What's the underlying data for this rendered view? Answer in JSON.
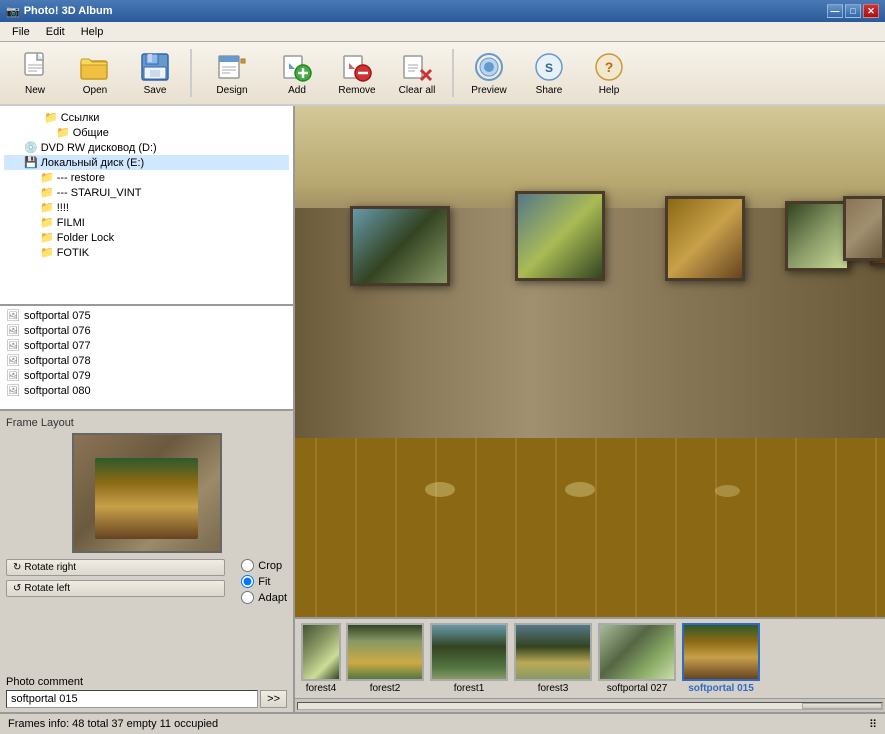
{
  "title_bar": {
    "icon": "📷",
    "title": "Photo! 3D Album",
    "min_btn": "—",
    "max_btn": "□",
    "close_btn": "✕"
  },
  "menu": {
    "items": [
      "File",
      "Edit",
      "Help"
    ]
  },
  "toolbar": {
    "buttons": [
      {
        "id": "new",
        "label": "New",
        "icon": "new"
      },
      {
        "id": "open",
        "label": "Open",
        "icon": "open"
      },
      {
        "id": "save",
        "label": "Save",
        "icon": "save"
      },
      {
        "id": "design",
        "label": "Design",
        "icon": "design"
      },
      {
        "id": "add",
        "label": "Add",
        "icon": "add"
      },
      {
        "id": "remove",
        "label": "Remove",
        "icon": "remove"
      },
      {
        "id": "clearall",
        "label": "Clear all",
        "icon": "clear"
      },
      {
        "id": "preview",
        "label": "Preview",
        "icon": "preview"
      },
      {
        "id": "share",
        "label": "Share",
        "icon": "share"
      },
      {
        "id": "help",
        "label": "Help",
        "icon": "help"
      }
    ]
  },
  "file_tree": {
    "items": [
      {
        "label": "Ссылки",
        "indent": 40,
        "icon": "📁"
      },
      {
        "label": "Общие",
        "indent": 52,
        "icon": "📁"
      },
      {
        "label": "DVD RW дисковод (D:)",
        "indent": 20,
        "icon": "💿"
      },
      {
        "label": "Локальный диск (E:)",
        "indent": 20,
        "icon": "💾"
      },
      {
        "label": "--- restore",
        "indent": 36,
        "icon": "📁"
      },
      {
        "label": "--- STARUI_VINT",
        "indent": 36,
        "icon": "📁"
      },
      {
        "label": "!!!!",
        "indent": 36,
        "icon": "📁"
      },
      {
        "label": "FILMI",
        "indent": 36,
        "icon": "📁"
      },
      {
        "label": "Folder Lock",
        "indent": 36,
        "icon": "📁"
      },
      {
        "label": "FOTIK",
        "indent": 36,
        "icon": "📁"
      }
    ]
  },
  "file_list": {
    "items": [
      {
        "label": "softportal 075",
        "icon": "🖼"
      },
      {
        "label": "softportal 076",
        "icon": "🖼"
      },
      {
        "label": "softportal 077",
        "icon": "🖼"
      },
      {
        "label": "softportal 078",
        "icon": "🖼"
      },
      {
        "label": "softportal 079",
        "icon": "🖼"
      },
      {
        "label": "softportal 080",
        "icon": "🖼"
      }
    ]
  },
  "frame_layout": {
    "label": "Frame Layout",
    "rotate_right_label": "Rotate right",
    "rotate_left_label": "Rotate left",
    "radio_options": [
      "Crop",
      "Fit",
      "Adapt"
    ],
    "selected_radio": "Fit"
  },
  "photo_comment": {
    "label": "Photo comment",
    "value": "softportal 015",
    "btn_label": ">>"
  },
  "thumbnails": [
    {
      "label": "forest4",
      "type": "forest4",
      "selected": false
    },
    {
      "label": "forest2",
      "type": "forest2",
      "selected": false
    },
    {
      "label": "forest1",
      "type": "forest",
      "selected": false
    },
    {
      "label": "forest3",
      "type": "forest3",
      "selected": false
    },
    {
      "label": "softportal 027",
      "type": "softportal027",
      "selected": false
    },
    {
      "label": "softportal 015",
      "type": "bbq",
      "selected": true
    }
  ],
  "status_bar": {
    "text": "Frames info:  48 total  37 empty  11 occupied"
  }
}
